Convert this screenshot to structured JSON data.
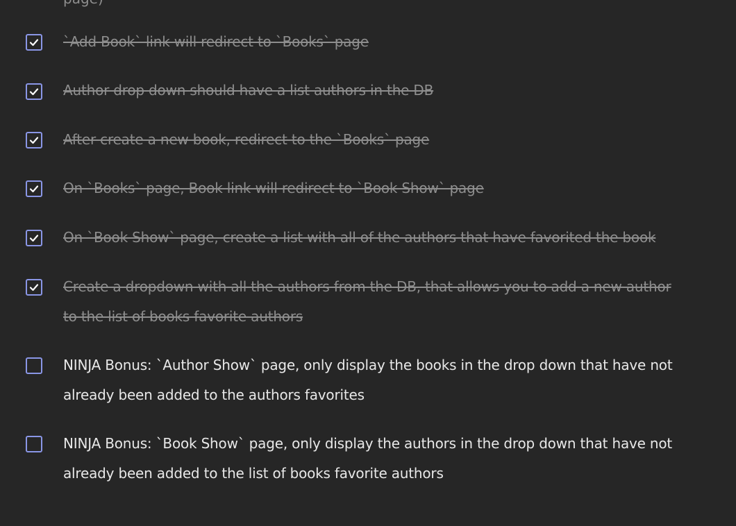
{
  "top_fragment": "page)",
  "items": [
    {
      "label": "`Add Book` link will redirect to `Books` page",
      "checked": true
    },
    {
      "label": "Author drop down should have a list authors in the DB",
      "checked": true
    },
    {
      "label": "After create a new book, redirect to the `Books` page",
      "checked": true
    },
    {
      "label": "On `Books` page, Book link will redirect to `Book Show` page",
      "checked": true
    },
    {
      "label": "On `Book Show` page, create a list with all of the authors that have favorited the book",
      "checked": true
    },
    {
      "label": "Create a dropdown with all the authors from the DB, that allows you to add a new author to the list of books favorite authors",
      "checked": true
    },
    {
      "label": "NINJA Bonus: `Author Show` page, only display the books in the drop down that have not already been added to the authors favorites",
      "checked": false
    },
    {
      "label": "NINJA Bonus: `Book Show` page, only display the authors in the drop down that have not already been added to the list of books favorite authors",
      "checked": false
    }
  ],
  "colors": {
    "background": "#262626",
    "checkbox_border": "#8a96e6",
    "check_mark": "#ffffff",
    "done_text": "#8e8e8e",
    "todo_text": "#e8e8e8"
  },
  "icons": {
    "checked": "check-icon"
  }
}
